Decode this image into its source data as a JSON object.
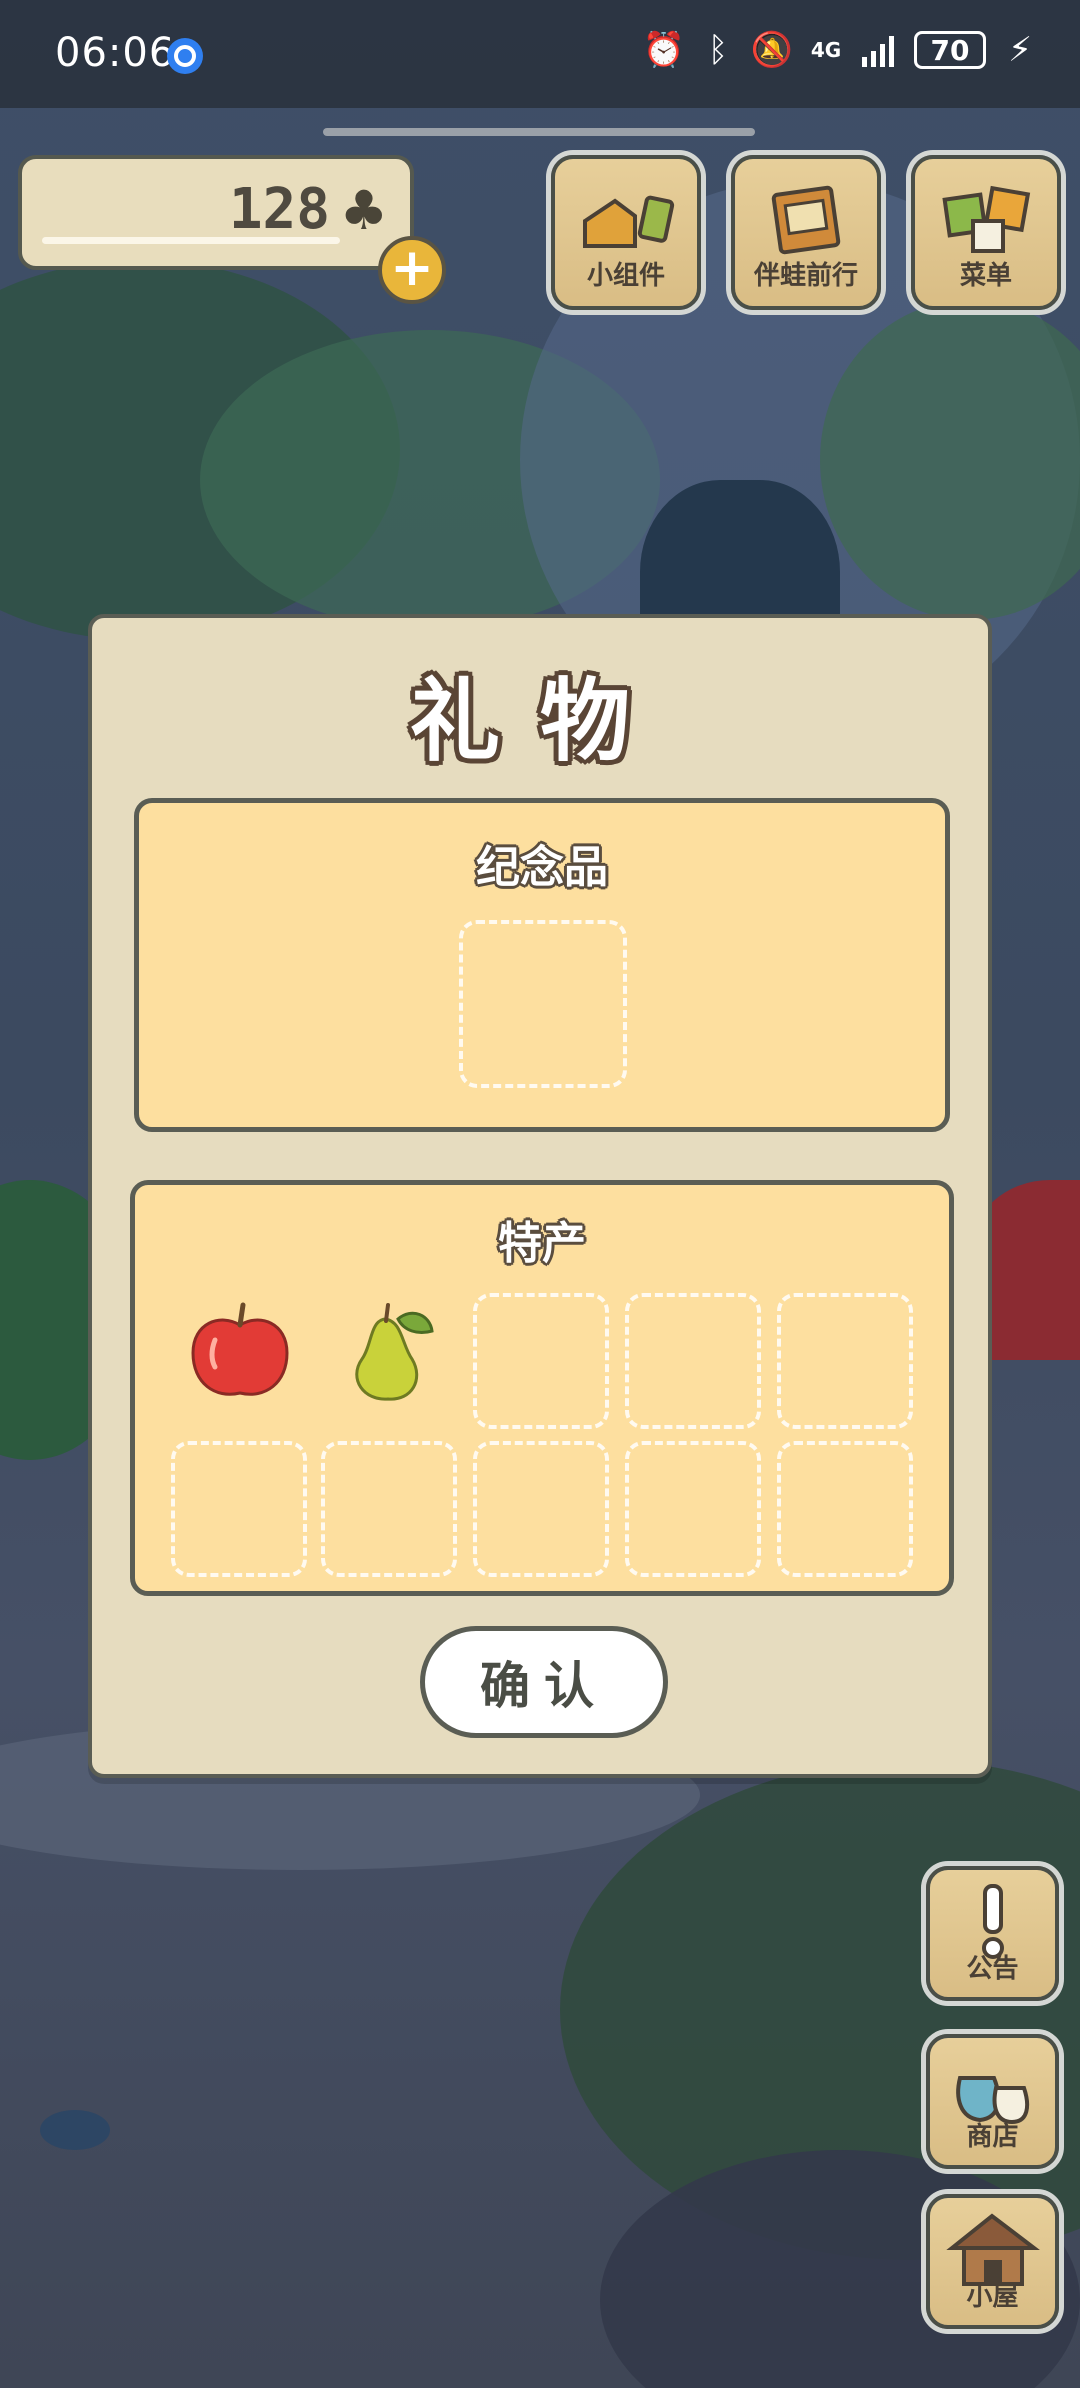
{
  "status_bar": {
    "time": "06:06",
    "network": "4G",
    "battery": "70",
    "icons": [
      "location-icon",
      "alarm-icon",
      "bluetooth-icon",
      "mute-icon",
      "signal-icon",
      "charging-icon"
    ]
  },
  "currency": {
    "count": "128",
    "icon": "clover-icon",
    "add_icon": "plus-icon"
  },
  "top_buttons": {
    "widget": "小组件",
    "travel_with_frog": "伴蛙前行",
    "menu": "菜单"
  },
  "side_buttons": {
    "notice": "公告",
    "shop": "商店",
    "house": "小屋"
  },
  "dialog": {
    "title": "礼物",
    "souvenir_title": "纪念品",
    "specialty_title": "特产",
    "specialty_items": [
      "apple",
      "pear"
    ],
    "confirm_label": "确认"
  },
  "colors": {
    "dialog_bg": "#e6dcbf",
    "panel_bg": "#fddf9f",
    "outline": "#5a5d54",
    "coin_button": "#e9b63a"
  }
}
